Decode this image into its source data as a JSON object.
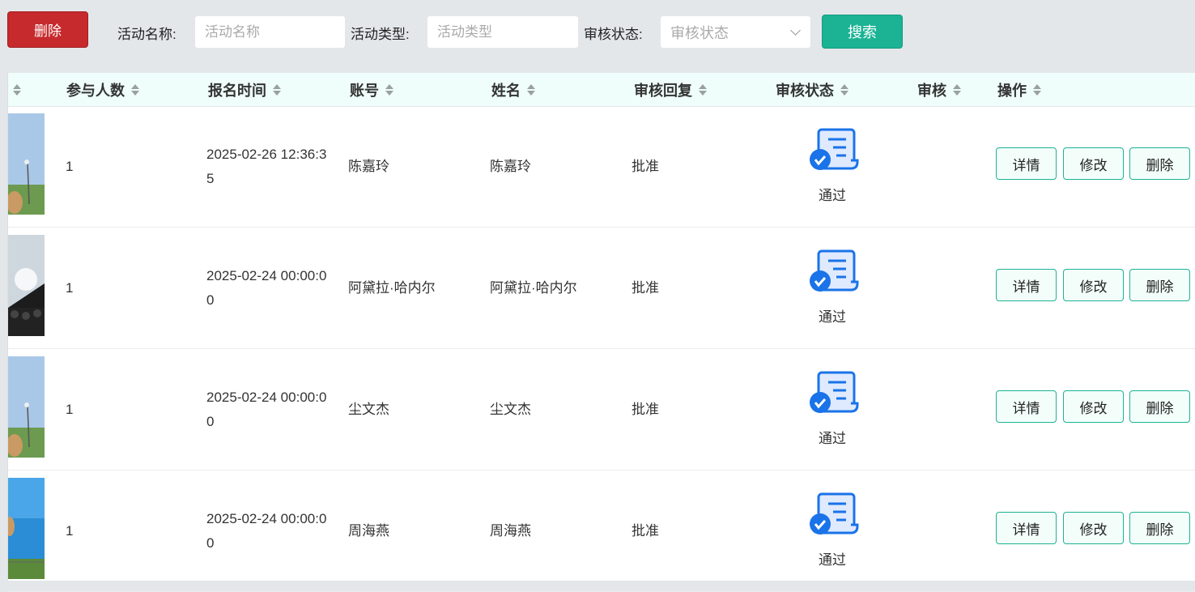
{
  "toolbar": {
    "delete_label": "删除",
    "name_label": "活动名称:",
    "name_placeholder": "活动名称",
    "type_label": "活动类型:",
    "type_placeholder": "活动类型",
    "status_label": "审核状态:",
    "status_placeholder": "审核状态",
    "search_label": "搜索"
  },
  "table": {
    "headers": [
      "参与人数",
      "报名时间",
      "账号",
      "姓名",
      "审核回复",
      "审核状态",
      "审核",
      "操作"
    ],
    "rows": [
      {
        "count": "1",
        "time": "2025-02-26 12:36:35",
        "account": "陈嘉玲",
        "name": "陈嘉玲",
        "reply": "批准",
        "status": "通过"
      },
      {
        "count": "1",
        "time": "2025-02-24 00:00:00",
        "account": "阿黛拉·哈内尔",
        "name": "阿黛拉·哈内尔",
        "reply": "批准",
        "status": "通过"
      },
      {
        "count": "1",
        "time": "2025-02-24 00:00:00",
        "account": "尘文杰",
        "name": "尘文杰",
        "reply": "批准",
        "status": "通过"
      },
      {
        "count": "1",
        "time": "2025-02-24 00:00:00",
        "account": "周海燕",
        "name": "周海燕",
        "reply": "批准",
        "status": "通过"
      }
    ],
    "actions": {
      "detail": "详情",
      "edit": "修改",
      "delete": "删除"
    }
  },
  "colors": {
    "accent": "#1bb394",
    "danger": "#c62a2c",
    "header_bg": "#effefa",
    "icon": "#1a73e8"
  }
}
